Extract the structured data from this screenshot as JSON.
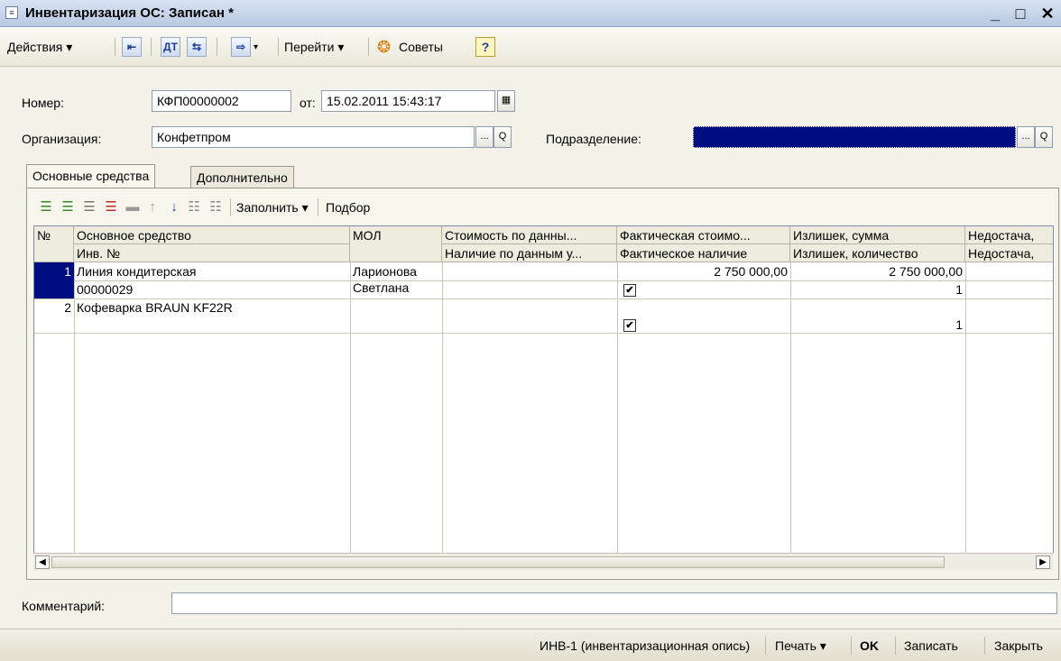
{
  "window": {
    "title": "Инвентаризация ОС: Записан *",
    "minimize": "_",
    "maximize": "□",
    "close": "✕"
  },
  "toolbar": {
    "actions_label": "Действия ▾",
    "goto_label": "Перейти ▾",
    "tips_label": "Советы",
    "help_label": "?"
  },
  "form": {
    "number_label": "Номер:",
    "number_value": "КФП00000002",
    "date_label": "от:",
    "date_value": "15.02.2011 15:43:17",
    "org_label": "Организация:",
    "org_value": "Конфетпром",
    "division_label": "Подразделение:",
    "division_value": "",
    "select_btn": "...",
    "open_btn": "Q"
  },
  "tabs": [
    {
      "label": "Основные средства"
    },
    {
      "label": "Дополнительно"
    }
  ],
  "grid_toolbar": {
    "fill_label": "Заполнить ▾",
    "pick_label": "Подбор"
  },
  "table": {
    "headers_row1": [
      "№",
      "Основное средство",
      "МОЛ",
      "Стоимость по данны...",
      "Фактическая стоимо...",
      "Излишек, сумма",
      "Недостача,"
    ],
    "headers_row2": [
      "",
      "Инв. №",
      "",
      "Наличие по данным у...",
      "Фактическое наличие",
      "Излишек, количество",
      "Недостача,"
    ],
    "rows": [
      {
        "num": "1",
        "asset": "Линия кондитерская",
        "inv": "00000029",
        "mol1": "Ларионова",
        "mol2": "Светлана",
        "fact_cost": "2 750 000,00",
        "surplus_sum": "2 750 000,00",
        "fact_presence": "✔",
        "surplus_qty": "1"
      },
      {
        "num": "2",
        "asset": "Кофеварка BRAUN KF22R",
        "inv": "",
        "mol1": "",
        "mol2": "",
        "fact_cost": "",
        "surplus_sum": "",
        "fact_presence": "✔",
        "surplus_qty": "1"
      }
    ]
  },
  "comment": {
    "label": "Комментарий:",
    "value": ""
  },
  "footer": {
    "inv1_label": "ИНВ-1 (инвентаризационная опись)",
    "print_label": "Печать ▾",
    "ok_label": "OK",
    "save_label": "Записать",
    "close_label": "Закрыть"
  },
  "colors": {
    "selection": "#000d80",
    "background": "#f4f2e8"
  }
}
